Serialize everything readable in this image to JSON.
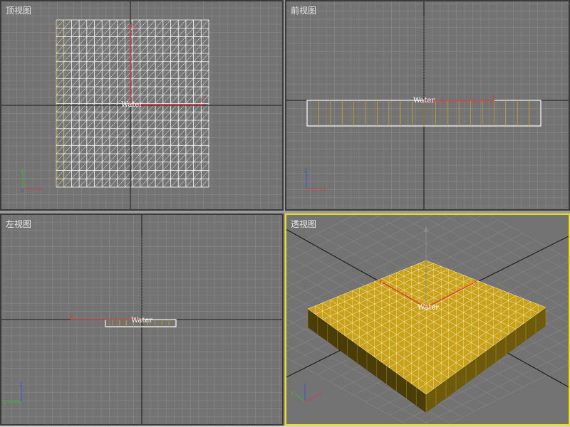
{
  "viewports": [
    {
      "id": "top",
      "label": "顶视图"
    },
    {
      "id": "front",
      "label": "前视图"
    },
    {
      "id": "left",
      "label": "左视图"
    },
    {
      "id": "persp",
      "label": "透视图"
    }
  ],
  "object_name": "Water",
  "axis_labels": {
    "x": "x",
    "y": "y",
    "z": "z"
  },
  "colors": {
    "viewport_bg": "#737373",
    "grid_minor": "#858585",
    "grid_major": "#2e2e2e",
    "wire": "#ffffff",
    "selected_wire": "#f4e16a",
    "gizmo_x": "#e03a3a",
    "gizmo_y": "#e03a3a",
    "gizmo_z": "#3a55e0",
    "active_border": "#f0e000",
    "mesh_fill": "#c8a21a"
  }
}
